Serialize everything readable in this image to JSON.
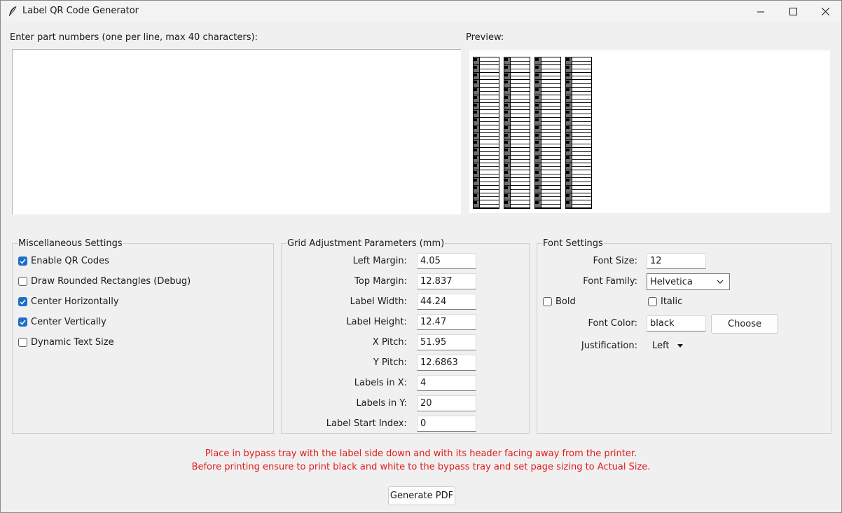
{
  "window": {
    "title": "Label QR Code Generator",
    "icon": "feather-icon"
  },
  "input": {
    "label": "Enter part numbers (one per line, max 40 characters):",
    "value": ""
  },
  "preview": {
    "label": "Preview:",
    "columns": 4,
    "rows": 20
  },
  "misc": {
    "title": "Miscellaneous Settings",
    "items": [
      {
        "label": "Enable QR Codes",
        "checked": true
      },
      {
        "label": "Draw Rounded Rectangles (Debug)",
        "checked": false
      },
      {
        "label": "Center Horizontally",
        "checked": true
      },
      {
        "label": "Center Vertically",
        "checked": true
      },
      {
        "label": "Dynamic Text Size",
        "checked": false
      }
    ]
  },
  "grid": {
    "title": "Grid Adjustment Parameters (mm)",
    "fields": [
      {
        "label": "Left Margin:",
        "value": "4.05"
      },
      {
        "label": "Top Margin:",
        "value": "12.837"
      },
      {
        "label": "Label Width:",
        "value": "44.24"
      },
      {
        "label": "Label Height:",
        "value": "12.47"
      },
      {
        "label": "X Pitch:",
        "value": "51.95"
      },
      {
        "label": "Y Pitch:",
        "value": "12.6863"
      },
      {
        "label": "Labels in X:",
        "value": "4"
      },
      {
        "label": "Labels in Y:",
        "value": "20"
      },
      {
        "label": "Label Start Index:",
        "value": "0"
      }
    ]
  },
  "font": {
    "title": "Font Settings",
    "size_label": "Font Size:",
    "size_value": "12",
    "family_label": "Font Family:",
    "family_value": "Helvetica",
    "bold_label": "Bold",
    "bold_checked": false,
    "italic_label": "Italic",
    "italic_checked": false,
    "color_label": "Font Color:",
    "color_value": "black",
    "choose_label": "Choose",
    "justification_label": "Justification:",
    "justification_value": "Left"
  },
  "notice": {
    "line1": "Place in bypass tray with the label side down and with its header facing away from the printer.",
    "line2": "Before printing ensure to print black and white to the bypass tray and set page sizing to Actual Size.",
    "color": "#e01b1b"
  },
  "generate_label": "Generate PDF",
  "accent_color": "#1e6ec8"
}
